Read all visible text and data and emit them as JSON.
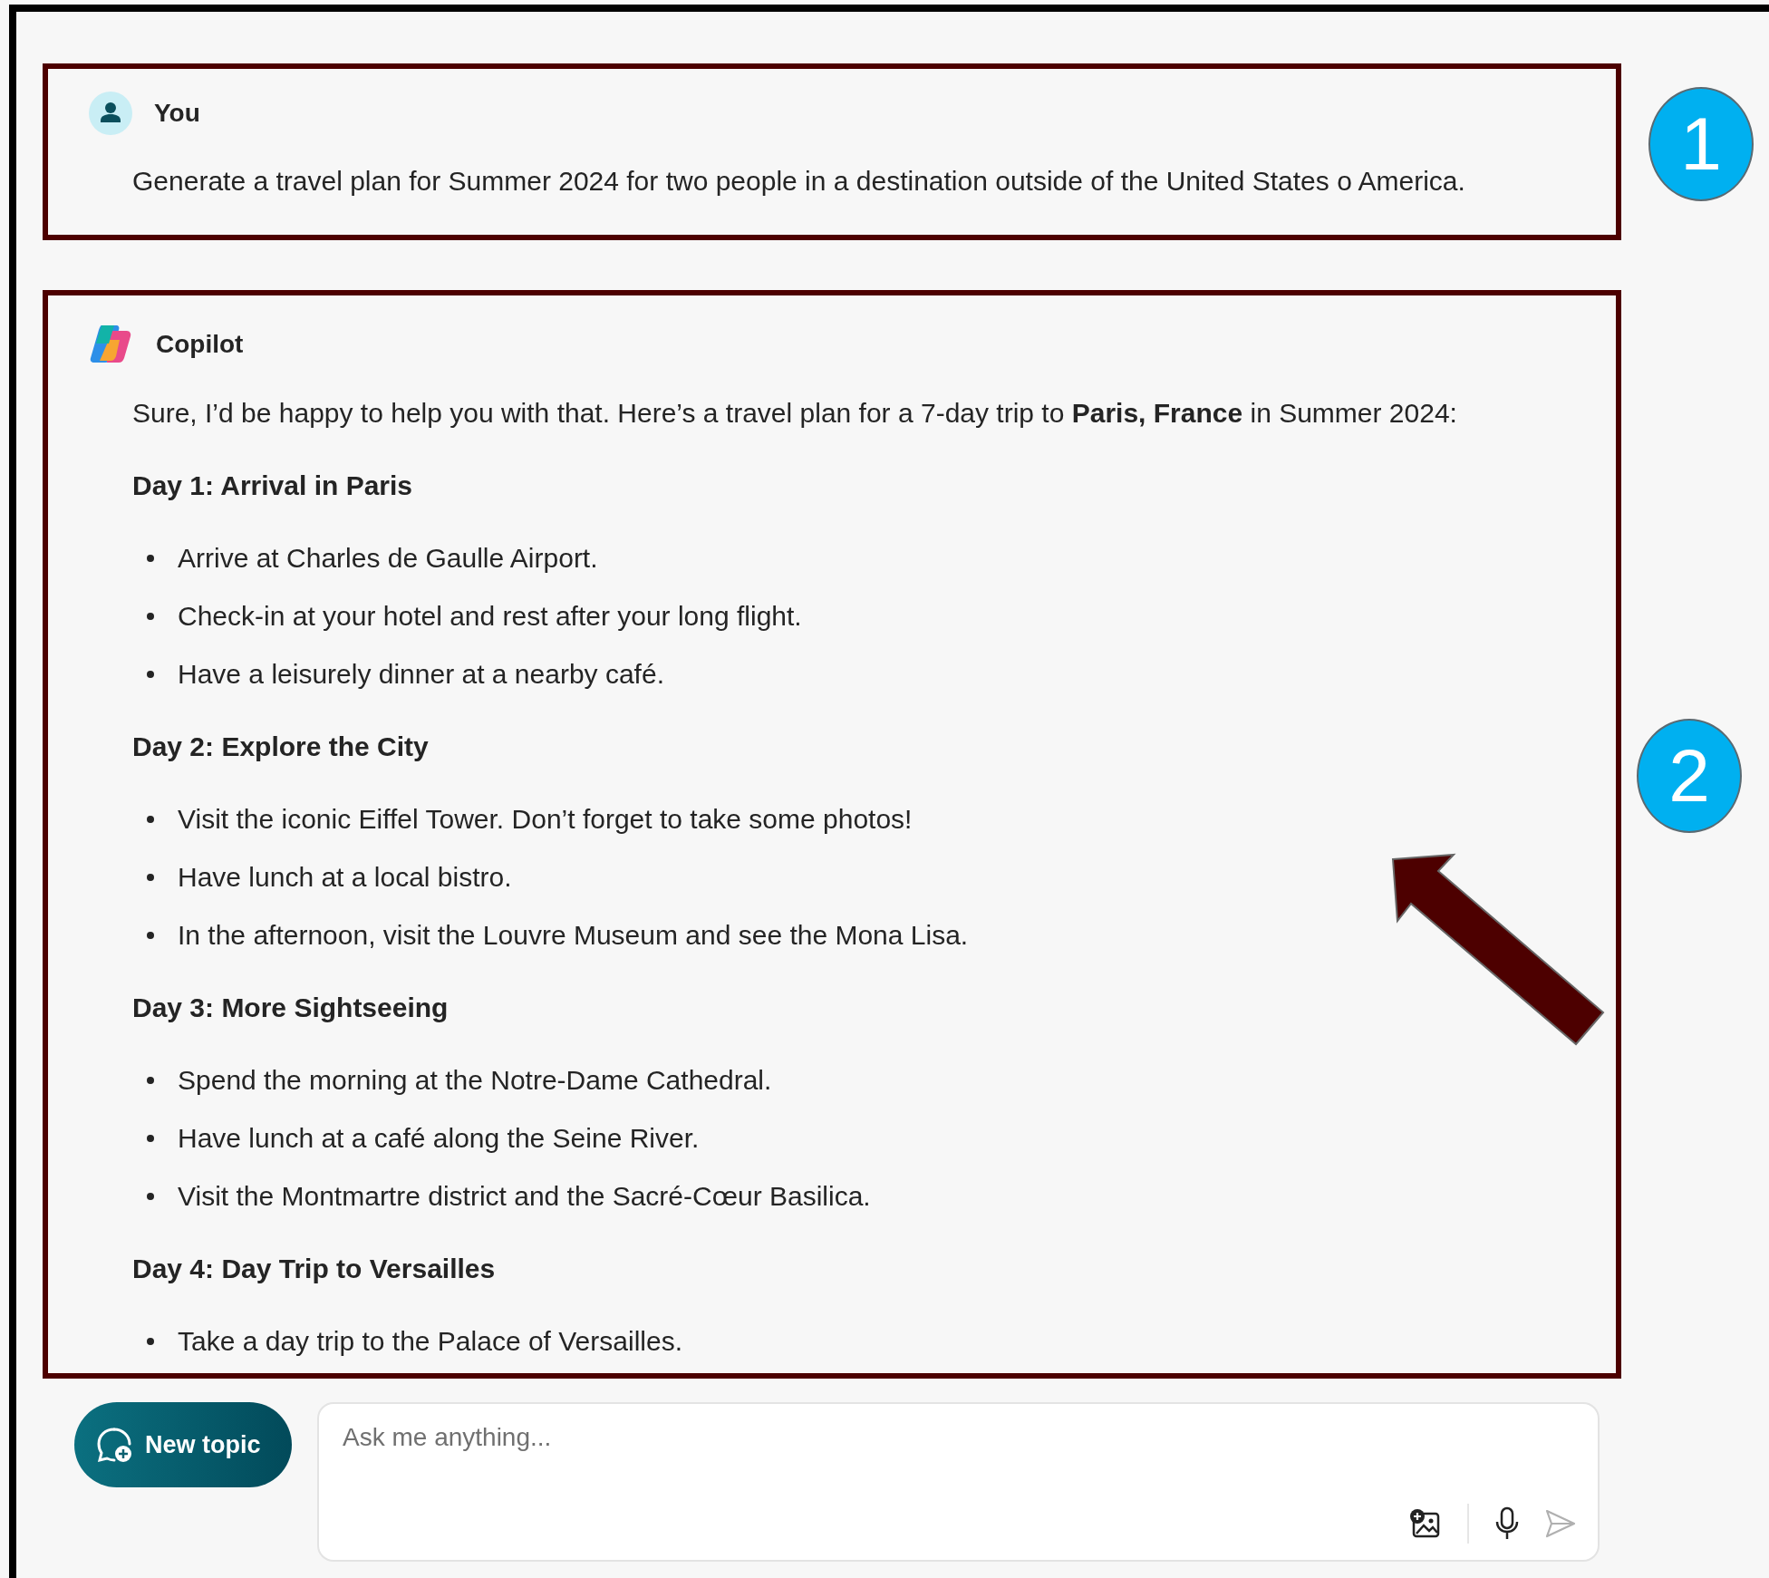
{
  "conversation": [
    {
      "kind": "user",
      "author": "You",
      "text": "Generate a travel plan for Summer 2024 for two people in a destination outside of the United States o America."
    },
    {
      "kind": "assistant",
      "author": "Copilot",
      "intro": "Sure, I’d be happy to help you with that. Here’s a travel plan for a 7-day trip to **Paris, France** in Summer 2024:",
      "sections": [
        {
          "heading": "Day 1: Arrival in Paris",
          "bullets": [
            "Arrive at Charles de Gaulle Airport.",
            "Check-in at your hotel and rest after your long flight.",
            "Have a leisurely dinner at a nearby café."
          ]
        },
        {
          "heading": "Day 2: Explore the City",
          "bullets": [
            "Visit the iconic Eiffel Tower. Don’t forget to take some photos!",
            "Have lunch at a local bistro.",
            "In the afternoon, visit the Louvre Museum and see the Mona Lisa."
          ]
        },
        {
          "heading": "Day 3: More Sightseeing",
          "bullets": [
            "Spend the morning at the Notre-Dame Cathedral.",
            "Have lunch at a café along the Seine River.",
            "Visit the Montmartre district and the Sacré-Cœur Basilica."
          ]
        },
        {
          "heading": "Day 4: Day Trip to Versailles",
          "bullets": [
            "Take a day trip to the Palace of Versailles."
          ]
        }
      ]
    }
  ],
  "composer": {
    "new_topic_button": "New topic",
    "placeholder": "Ask me anything..."
  },
  "callouts": [
    "1",
    "2"
  ]
}
